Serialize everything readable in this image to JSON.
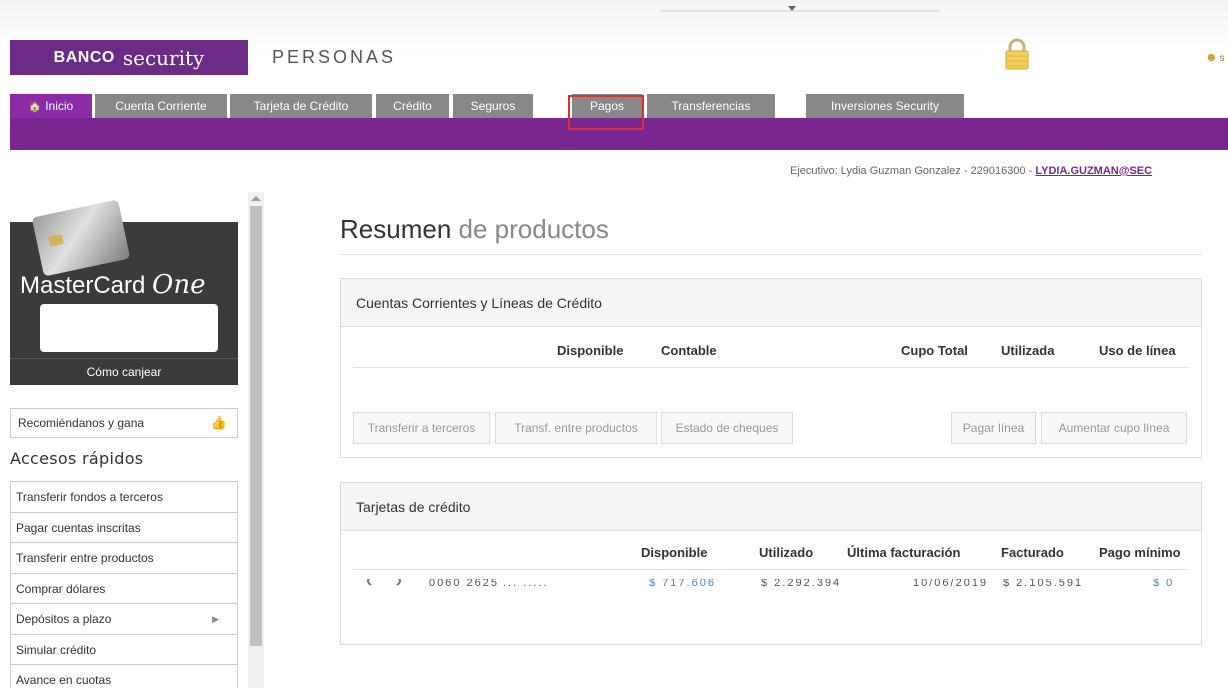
{
  "header": {
    "logo_banco": "BANCO",
    "logo_security": "security",
    "section": "PERSONAS",
    "user_link": "s"
  },
  "nav": {
    "items": [
      {
        "label": "Inicio",
        "active": true,
        "icon": "home-icon"
      },
      {
        "label": "Cuenta Corriente"
      },
      {
        "label": "Tarjeta de Crédito"
      },
      {
        "label": "Crédito"
      },
      {
        "label": "Seguros"
      },
      {
        "label": "Pagos",
        "highlighted": true
      },
      {
        "label": "Transferencias"
      },
      {
        "label": "Inversiones Security"
      }
    ]
  },
  "ejecutivo": {
    "text": "Ejecutivo: Lydia Guzman Gonzalez - 229016300 - ",
    "email": "LYDIA.GUZMAN@SEC"
  },
  "sidebar": {
    "card_title": "MasterCard",
    "card_title_script": "One",
    "card_footer": "Cómo canjear",
    "recommend": "Recomiéndanos y gana",
    "quick_title": "Accesos rápidos",
    "quick_links": [
      "Transferir fondos a terceros",
      "Pagar cuentas inscritas",
      "Transferir entre productos",
      "Comprar dólares",
      "Depósitos a plazo",
      "Simular crédito",
      "Avance en cuotas"
    ]
  },
  "main": {
    "title_bold": "Resumen",
    "title_light": "de productos",
    "cuentas": {
      "header": "Cuentas Corrientes y Líneas de Crédito",
      "columns": [
        "Disponible",
        "Contable",
        "Cupo Total",
        "Utilizada",
        "Uso de línea"
      ],
      "buttons": [
        "Transferir a terceros",
        "Transf. entre productos",
        "Estado de cheques",
        "Pagar línea",
        "Aumentar cupo línea"
      ]
    },
    "tarjetas": {
      "header": "Tarjetas de crédito",
      "columns": [
        "Disponible",
        "Utilizado",
        "Última facturación",
        "Facturado",
        "Pago mínimo"
      ],
      "row_partial": {
        "number": "0060 2625",
        "holder": "... .....",
        "disponible": "$ 717.606",
        "utilizado": "$ 2.292.394",
        "ultima": "10/06/2019",
        "facturado": "$ 2.105.591",
        "pago_minimo": "$ 0"
      }
    }
  },
  "colors": {
    "brand_purple": "#7a2691",
    "nav_gray": "#888888",
    "highlight_red": "#d93030",
    "link_blue": "#4a7fd4"
  }
}
